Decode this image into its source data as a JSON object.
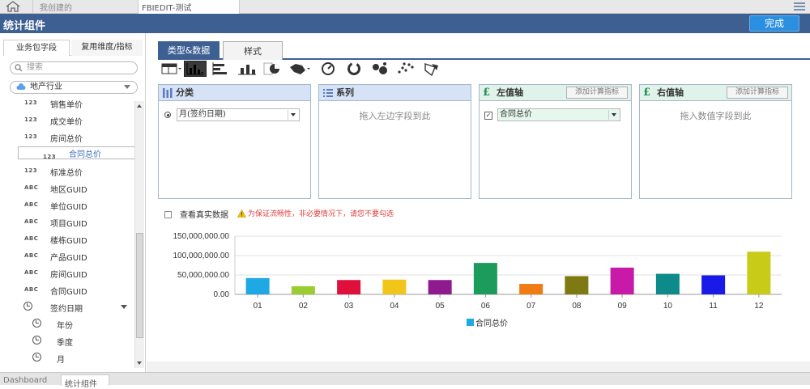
{
  "topbar": {
    "tab1": "我创建的",
    "tab2": "FBIEDIT-测试"
  },
  "header": {
    "title": "统计组件",
    "done_label": "完成"
  },
  "left": {
    "tab_a": "业务包字段",
    "tab_b": "复用维度/指标",
    "search_placeholder": "搜索",
    "package": "地产行业",
    "fields": [
      {
        "type": "123",
        "label": "销售单价"
      },
      {
        "type": "123",
        "label": "成交单价"
      },
      {
        "type": "123",
        "label": "房间总价"
      },
      {
        "type": "123",
        "label": "合同总价"
      },
      {
        "type": "123",
        "label": "标准总价"
      },
      {
        "type": "ABC",
        "label": "地区GUID"
      },
      {
        "type": "ABC",
        "label": "单位GUID"
      },
      {
        "type": "ABC",
        "label": "项目GUID"
      },
      {
        "type": "ABC",
        "label": "楼栋GUID"
      },
      {
        "type": "ABC",
        "label": "产品GUID"
      },
      {
        "type": "ABC",
        "label": "房间GUID"
      },
      {
        "type": "ABC",
        "label": "合同GUID"
      },
      {
        "type": "clock",
        "label": "签约日期"
      },
      {
        "type": "clock",
        "label": "年份"
      },
      {
        "type": "clock",
        "label": "季度"
      },
      {
        "type": "clock",
        "label": "月"
      }
    ]
  },
  "bottom_tabs": {
    "dashboard": "Dashboard",
    "stat": "统计组件"
  },
  "main": {
    "tab_type": "类型&数据",
    "tab_style": "样式",
    "panels": {
      "category": {
        "title": "分类",
        "value": "月(签约日期)"
      },
      "series": {
        "title": "系列",
        "hint": "拖入左边字段到此"
      },
      "left_axis": {
        "title": "左值轴",
        "add": "添加计算指标",
        "value": "合同总价"
      },
      "right_axis": {
        "title": "右值轴",
        "add": "添加计算指标",
        "hint": "拖入数值字段到此"
      }
    },
    "real_data_label": "查看真实数据",
    "warning": "为保证流畅性，非必要情况下，请您不要勾选"
  },
  "colors": {
    "accent": "#3e5f92",
    "done": "#2b8fe0"
  },
  "chart_data": {
    "type": "bar",
    "categories": [
      "01",
      "02",
      "03",
      "04",
      "05",
      "06",
      "07",
      "08",
      "09",
      "10",
      "11",
      "12"
    ],
    "series": [
      {
        "name": "合同总价",
        "values": [
          42000000,
          21000000,
          37000000,
          38000000,
          37000000,
          81000000,
          27000000,
          47000000,
          69000000,
          53000000,
          49000000,
          110000000
        ]
      }
    ],
    "colors": [
      "#1ea9e5",
      "#9acd32",
      "#e0103c",
      "#f2c51a",
      "#8e1a8e",
      "#1c9b5a",
      "#f07b12",
      "#7d7a14",
      "#c81aa8",
      "#0f8a8a",
      "#1a1ae8",
      "#c8cc18"
    ],
    "yticks": [
      "0.00",
      "50,000,000.00",
      "100,000,000.00",
      "150,000,000.00"
    ],
    "ylim": [
      0,
      150000000
    ],
    "grid": true,
    "legend": "bottom"
  }
}
